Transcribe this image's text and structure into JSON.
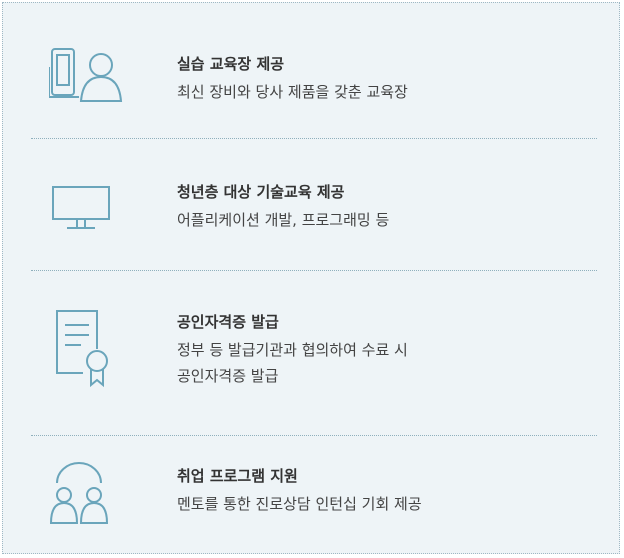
{
  "items": [
    {
      "title": "실습 교육장 제공",
      "desc_lines": [
        "최신 장비와 당사 제품을 갖춘 교육장"
      ],
      "icon": "device-user-icon"
    },
    {
      "title": "청년층 대상 기술교육 제공",
      "desc_lines": [
        "어플리케이션 개발, 프로그래밍 등"
      ],
      "icon": "monitor-icon"
    },
    {
      "title": "공인자격증 발급",
      "desc_lines": [
        "정부 등 발급기관과 협의하여 수료 시",
        "공인자격증 발급"
      ],
      "icon": "certificate-icon"
    },
    {
      "title": "취업 프로그램 지원",
      "desc_lines": [
        "멘토를 통한 진로상담 인턴십 기회 제공"
      ],
      "icon": "mentor-people-icon"
    }
  ],
  "colors": {
    "background": "#eef4f7",
    "icon": "#6aa5bb",
    "divider": "#8fb0bd"
  }
}
